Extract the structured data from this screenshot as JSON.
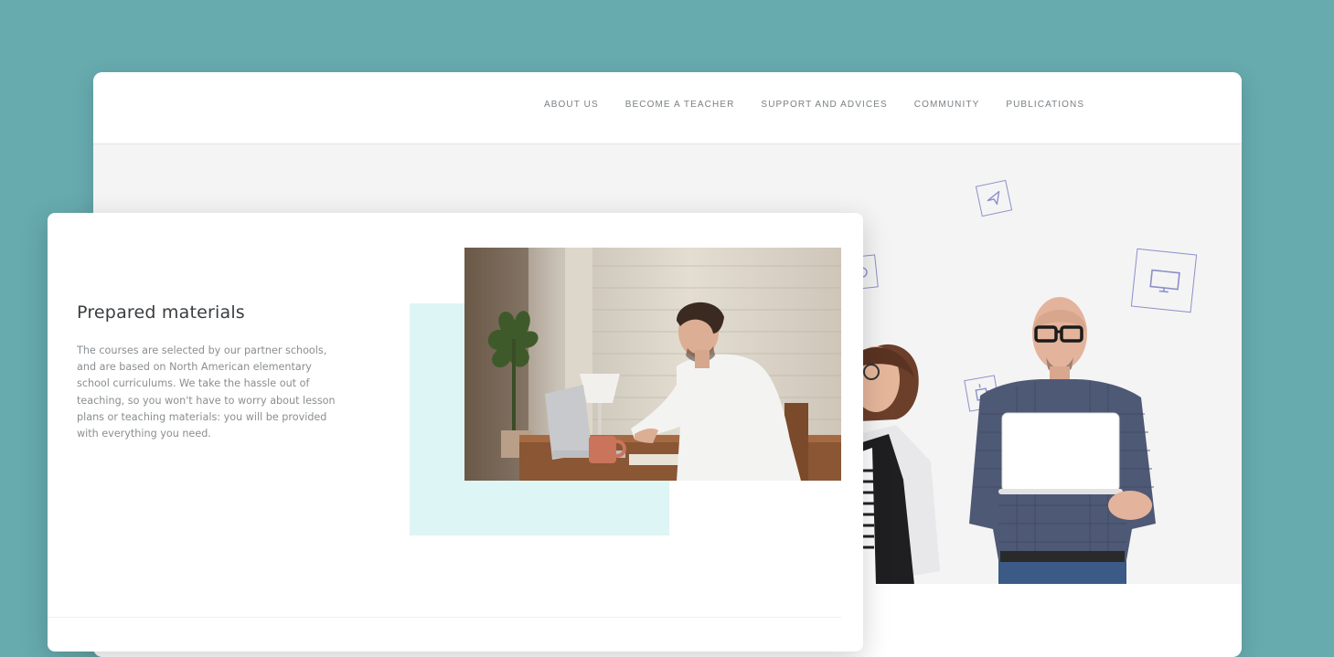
{
  "nav": {
    "items": [
      {
        "label": "ABOUT US"
      },
      {
        "label": "BECOME A TEACHER"
      },
      {
        "label": "SUPPORT AND ADVICES"
      },
      {
        "label": "COMMUNITY"
      },
      {
        "label": "PUBLICATIONS"
      }
    ]
  },
  "card": {
    "title": "Prepared materials",
    "body": "The courses are selected by our partner schools, and are based on North American elementary school curriculums. We take the hassle out of teaching, so you won't have to worry about lesson plans or teaching materials: you will be provided with everything you need."
  },
  "colors": {
    "background": "#67abaf",
    "hero_background": "#f4f4f4",
    "accent_mint": "#ddf5f4",
    "icon_outline": "#8c8fc9"
  },
  "icons": [
    "send-icon",
    "monitor-icon",
    "cup-icon",
    "chat-icon"
  ]
}
